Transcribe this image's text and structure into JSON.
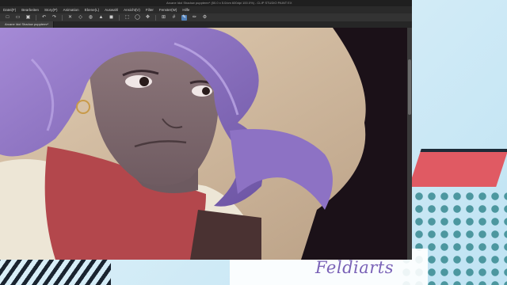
{
  "window": {
    "title": "Arcane Idol Shadow pupptemr* (50.0 x 5.0/cm 600dpi 100.0%) - CLIP STUDIO PAINT EX"
  },
  "menu": [
    {
      "label": "Datei(F)"
    },
    {
      "label": "Bearbeiten"
    },
    {
      "label": "Story(P)"
    },
    {
      "label": "Animation"
    },
    {
      "label": "Ebene(L)"
    },
    {
      "label": "Auswahl"
    },
    {
      "label": "Ansicht(V)"
    },
    {
      "label": "Filter"
    },
    {
      "label": "Fenster(W)"
    },
    {
      "label": "Hilfe"
    }
  ],
  "toolbar": {
    "icons": [
      "new-file-icon",
      "open-icon",
      "save-icon",
      "undo-icon",
      "redo-icon",
      "clear-icon",
      "transform-icon",
      "fill-icon",
      "brush-icon",
      "eraser-icon",
      "select-icon",
      "lasso-icon",
      "move-icon",
      "snap-icon",
      "grid-icon",
      "ruler-icon",
      "pen-icon",
      "pencil-icon",
      "settings-icon"
    ]
  },
  "tabs": [
    {
      "label": "Arcane Idol Shadow pupptemr*"
    }
  ],
  "watermark": {
    "text": "Feldiarts"
  },
  "colors": {
    "accent": "#4f7fb8",
    "hair": "#8a6fbf",
    "skin": "#7f6a6f",
    "shirt": "#b8454a",
    "background": "#cdb79c",
    "decor_red": "#e05a63",
    "decor_teal": "#3f8e96",
    "signature": "#7a62b7"
  }
}
